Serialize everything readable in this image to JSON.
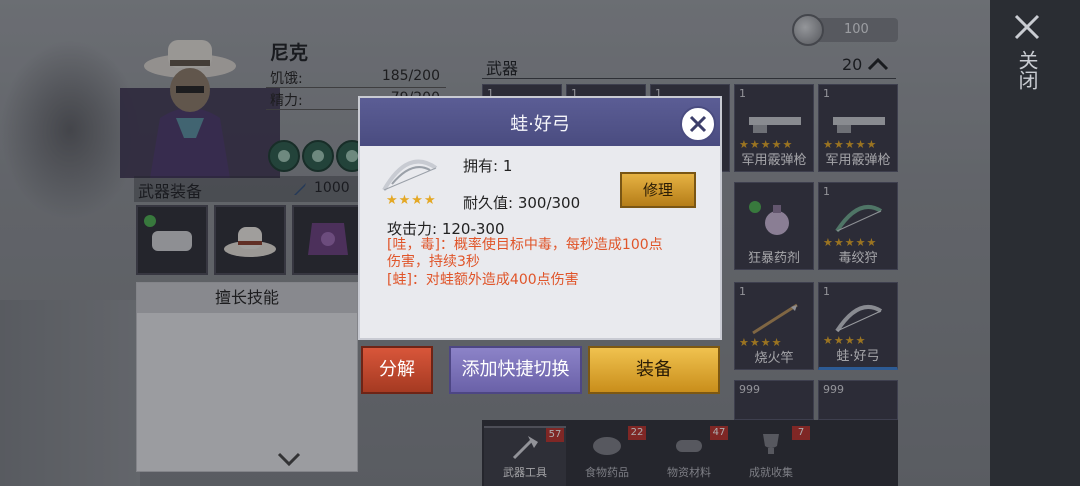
{
  "window": {
    "close_label": "关闭"
  },
  "character": {
    "name": "尼克",
    "stats": [
      {
        "label": "饥饿:",
        "value": "185/200"
      },
      {
        "label": "精力:",
        "value": "79/200"
      }
    ]
  },
  "equipment": {
    "title": "武器装备",
    "attack_value": "1000"
  },
  "skills": {
    "title": "擅长技能"
  },
  "currency": {
    "value": "100"
  },
  "inventory": {
    "title": "武器",
    "count": "20",
    "slots": [
      {
        "qty": "1",
        "name": "",
        "stars": ""
      },
      {
        "qty": "1",
        "name": "",
        "stars": ""
      },
      {
        "qty": "1",
        "name": "",
        "stars": ""
      },
      {
        "qty": "1",
        "name": "军用霰弹枪",
        "stars": "★★★★★"
      },
      {
        "qty": "1",
        "name": "军用霰弹枪",
        "stars": "★★★★★"
      },
      {
        "qty": "",
        "name": "狂暴药剂",
        "stars": ""
      },
      {
        "qty": "1",
        "name": "毒绞狩",
        "stars": "★★★★★"
      },
      {
        "qty": "1",
        "name": "烧火竿",
        "stars": "★★★★"
      },
      {
        "qty": "1",
        "name": "蛙·好弓",
        "stars": "★★★★"
      },
      {
        "qty": "999",
        "name": "",
        "stars": ""
      },
      {
        "qty": "999",
        "name": "",
        "stars": ""
      }
    ],
    "tabs": [
      {
        "label": "武器工具",
        "badge": "57"
      },
      {
        "label": "食物药品",
        "badge": "22"
      },
      {
        "label": "物资材料",
        "badge": "47"
      },
      {
        "label": "成就收集",
        "badge": "7"
      }
    ]
  },
  "dialog": {
    "title": "蛙·好弓",
    "stars": "★★★★",
    "owned": "拥有:  1",
    "durability": "耐久值:  300/300",
    "repair_label": "修理",
    "attack": "攻击力:  120-300",
    "desc_lines": [
      "[哇，毒]：概率使目标中毒，每秒造成100点",
      "伤害，持续3秒",
      "[蛙]：对蛙额外造成400点伤害"
    ]
  },
  "actions": {
    "decompose": "分解",
    "quick_switch": "添加快捷切换",
    "equip": "装备"
  },
  "colors": {
    "dialog_header": "#4a4c80",
    "accent_gold": "#e4a825",
    "desc_text": "#e0552a",
    "danger": "#b8322c"
  }
}
